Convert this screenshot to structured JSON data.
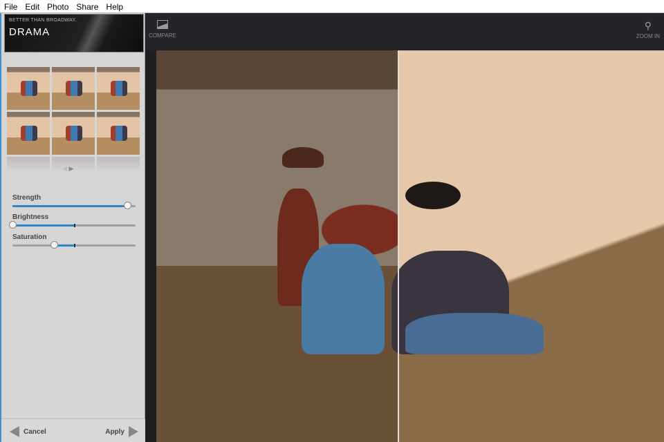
{
  "menu": [
    "File",
    "Edit",
    "Photo",
    "Share",
    "Help"
  ],
  "effect": {
    "tagline": "BETTER THAN BROADWAY.",
    "name": "DRAMA"
  },
  "thumbnails": {
    "count": 9
  },
  "sliders": [
    {
      "label": "Strength",
      "value": 0.93,
      "centered": false
    },
    {
      "label": "Brightness",
      "value": 0.0,
      "centered": true
    },
    {
      "label": "Saturation",
      "value": 0.335,
      "centered": true
    }
  ],
  "footer": {
    "cancel": "Cancel",
    "apply": "Apply"
  },
  "toolbar": {
    "compare": "COMPARE",
    "zoom_in": "ZOOM IN"
  },
  "accent": "#2f86c2"
}
